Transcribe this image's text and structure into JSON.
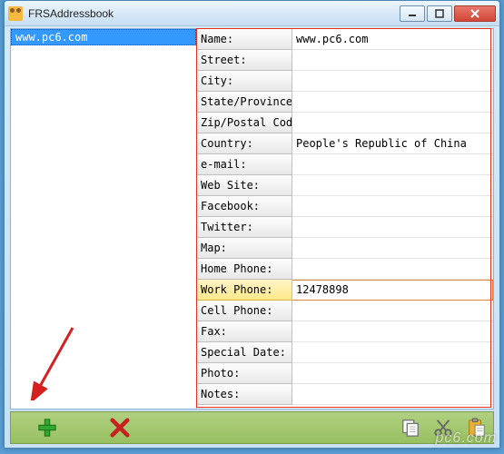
{
  "window": {
    "title": "FRSAddressbook"
  },
  "contacts": {
    "items": [
      {
        "label": "www.pc6.com",
        "selected": true
      }
    ]
  },
  "fields": [
    {
      "label": "Name:",
      "value": "www.pc6.com"
    },
    {
      "label": "Street:",
      "value": ""
    },
    {
      "label": "City:",
      "value": ""
    },
    {
      "label": "State/Province:",
      "value": ""
    },
    {
      "label": "Zip/Postal Code:",
      "value": ""
    },
    {
      "label": "Country:",
      "value": "People's Republic of China"
    },
    {
      "label": "e-mail:",
      "value": ""
    },
    {
      "label": "Web Site:",
      "value": ""
    },
    {
      "label": "Facebook:",
      "value": ""
    },
    {
      "label": "Twitter:",
      "value": ""
    },
    {
      "label": "Map:",
      "value": ""
    },
    {
      "label": "Home Phone:",
      "value": ""
    },
    {
      "label": "Work Phone:",
      "value": "12478898",
      "selected": true
    },
    {
      "label": "Cell Phone:",
      "value": ""
    },
    {
      "label": "Fax:",
      "value": ""
    },
    {
      "label": "Special Date:",
      "value": ""
    },
    {
      "label": "Photo:",
      "value": ""
    },
    {
      "label": "Notes:",
      "value": ""
    }
  ],
  "watermark": "pc6.com"
}
